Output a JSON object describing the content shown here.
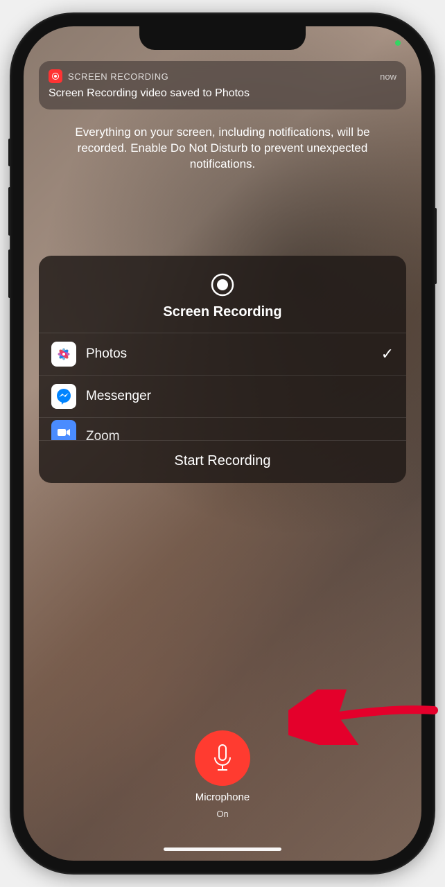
{
  "notification": {
    "app_name": "SCREEN RECORDING",
    "time": "now",
    "body": "Screen Recording video saved to Photos"
  },
  "info_text": "Everything on your screen, including notifications, will be recorded. Enable Do Not Disturb to prevent unexpected notifications.",
  "popup": {
    "title": "Screen Recording",
    "apps": [
      {
        "name": "Photos",
        "selected": true
      },
      {
        "name": "Messenger",
        "selected": false
      },
      {
        "name": "Zoom",
        "selected": false
      }
    ],
    "start_label": "Start Recording"
  },
  "microphone": {
    "label": "Microphone",
    "state": "On"
  },
  "colors": {
    "accent_red": "#ff3b30"
  }
}
